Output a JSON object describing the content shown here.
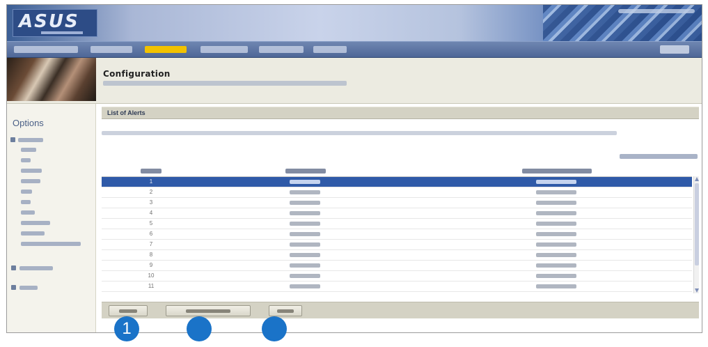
{
  "app": {
    "brand": "ASUS"
  },
  "page": {
    "title": "Configuration"
  },
  "sidebar": {
    "heading": "Options"
  },
  "section": {
    "title": "List of Alerts"
  },
  "table": {
    "rows": [
      {
        "num": "1",
        "selected": true
      },
      {
        "num": "2"
      },
      {
        "num": "3"
      },
      {
        "num": "4"
      },
      {
        "num": "5"
      },
      {
        "num": "6"
      },
      {
        "num": "7"
      },
      {
        "num": "8"
      },
      {
        "num": "9"
      },
      {
        "num": "10"
      },
      {
        "num": "11"
      }
    ]
  },
  "callouts": {
    "first": "1"
  },
  "colors": {
    "selected_row": "#2f5aa8",
    "callout": "#1a73c8",
    "nav_active": "#f2c200"
  }
}
